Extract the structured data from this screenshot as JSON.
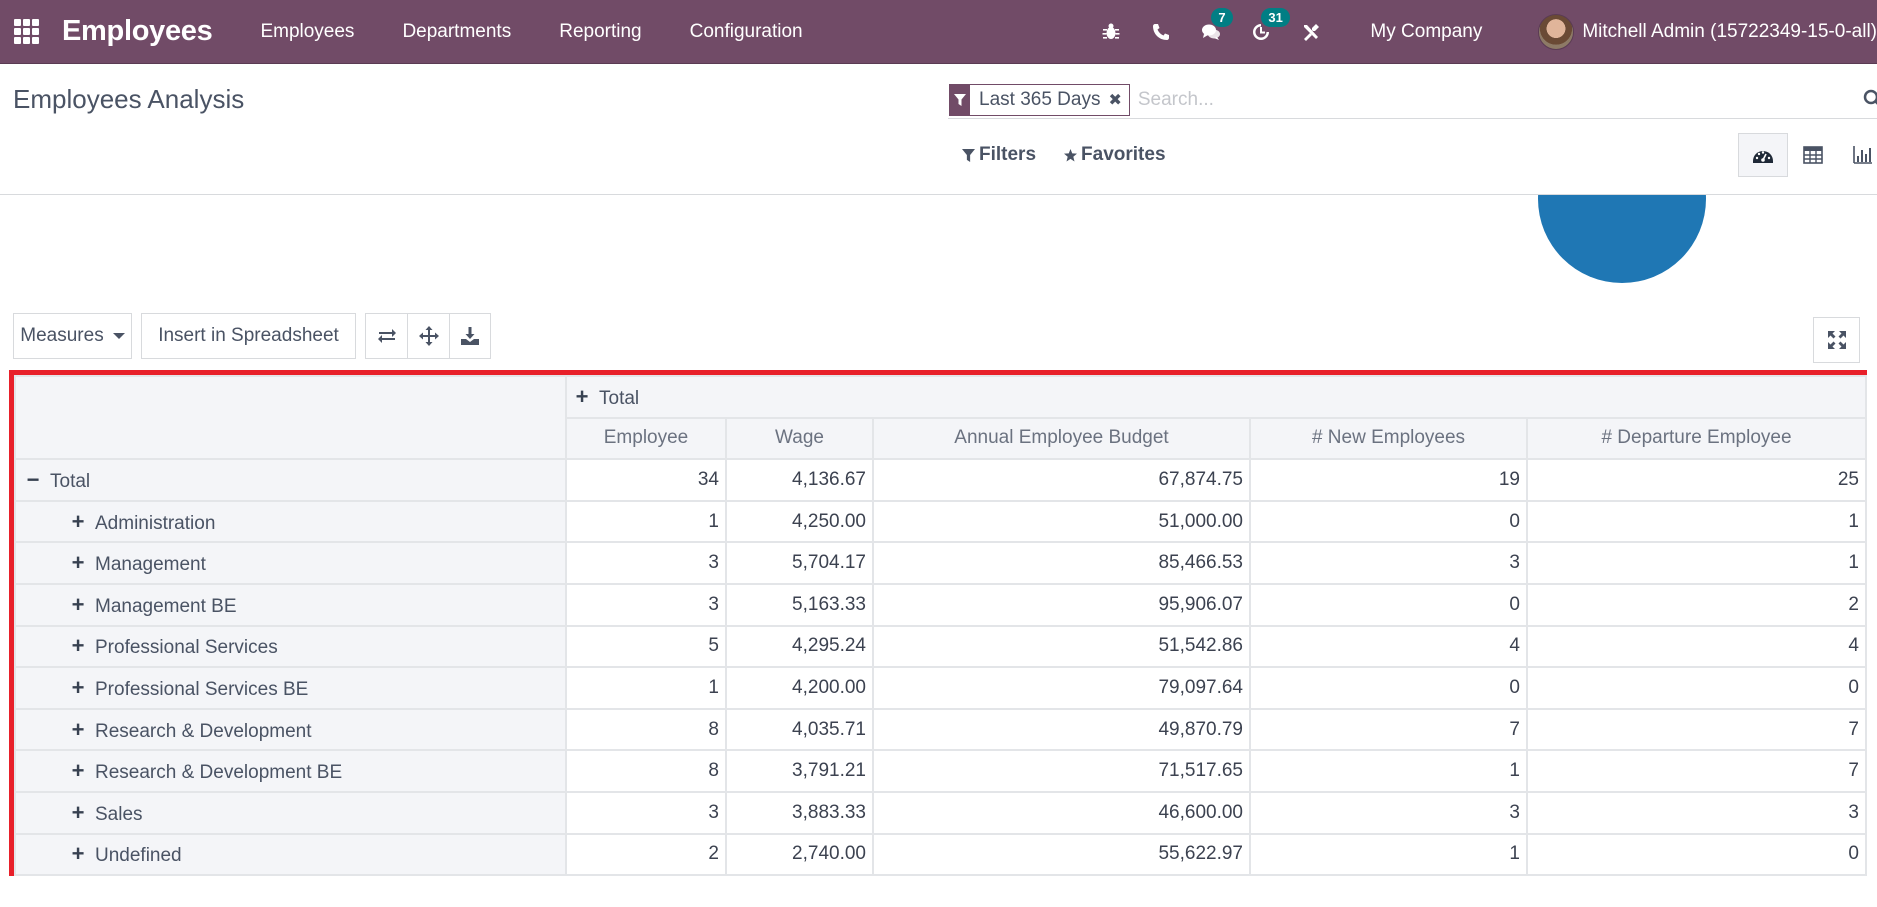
{
  "navbar": {
    "app_name": "Employees",
    "menu": [
      "Employees",
      "Departments",
      "Reporting",
      "Configuration"
    ],
    "messages_badge": "7",
    "activities_badge": "31",
    "company": "My Company",
    "user": "Mitchell Admin (15722349-15-0-all)",
    "brand_color": "#714b67",
    "badge_color": "#017e84"
  },
  "control_panel": {
    "title": "Employees Analysis",
    "facet": "Last 365 Days",
    "search_placeholder": "Search...",
    "filters_label": "Filters",
    "favorites_label": "Favorites",
    "views": [
      "graph",
      "pivot",
      "bar-chart"
    ],
    "active_view": "graph"
  },
  "toolbar": {
    "measures_label": "Measures",
    "insert_label": "Insert in Spreadsheet"
  },
  "pivot": {
    "column_group": "Total",
    "measures": [
      "Employee",
      "Wage",
      "Annual Employee Budget",
      "# New Employees",
      "# Departure Employee"
    ],
    "rows": [
      {
        "label": "Total",
        "level": 0,
        "expanded": true,
        "values": [
          "34",
          "4,136.67",
          "67,874.75",
          "19",
          "25"
        ]
      },
      {
        "label": "Administration",
        "level": 1,
        "expanded": false,
        "values": [
          "1",
          "4,250.00",
          "51,000.00",
          "0",
          "1"
        ]
      },
      {
        "label": "Management",
        "level": 1,
        "expanded": false,
        "values": [
          "3",
          "5,704.17",
          "85,466.53",
          "3",
          "1"
        ]
      },
      {
        "label": "Management BE",
        "level": 1,
        "expanded": false,
        "values": [
          "3",
          "5,163.33",
          "95,906.07",
          "0",
          "2"
        ]
      },
      {
        "label": "Professional Services",
        "level": 1,
        "expanded": false,
        "values": [
          "5",
          "4,295.24",
          "51,542.86",
          "4",
          "4"
        ]
      },
      {
        "label": "Professional Services BE",
        "level": 1,
        "expanded": false,
        "values": [
          "1",
          "4,200.00",
          "79,097.64",
          "0",
          "0"
        ]
      },
      {
        "label": "Research & Development",
        "level": 1,
        "expanded": false,
        "values": [
          "8",
          "4,035.71",
          "49,870.79",
          "7",
          "7"
        ]
      },
      {
        "label": "Research & Development BE",
        "level": 1,
        "expanded": false,
        "values": [
          "8",
          "3,791.21",
          "71,517.65",
          "1",
          "7"
        ]
      },
      {
        "label": "Sales",
        "level": 1,
        "expanded": false,
        "values": [
          "3",
          "3,883.33",
          "46,600.00",
          "3",
          "3"
        ]
      },
      {
        "label": "Undefined",
        "level": 1,
        "expanded": false,
        "values": [
          "2",
          "2,740.00",
          "55,622.97",
          "1",
          "0"
        ]
      }
    ]
  }
}
